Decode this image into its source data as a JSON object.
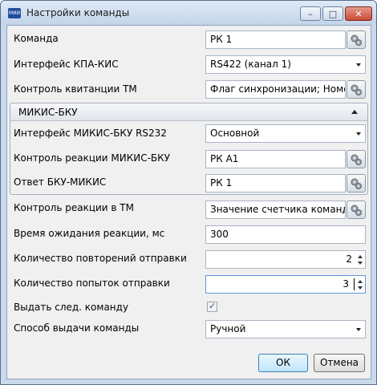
{
  "window": {
    "title": "Настройки команды",
    "icon": "app-logo-icon",
    "icon_text": "МИИ",
    "buttons": {
      "minimize": "–",
      "maximize": "□",
      "close": "✕"
    }
  },
  "fields": {
    "command": {
      "label": "Команда",
      "value": "РК 1"
    },
    "interface_kpa_kis": {
      "label": "Интерфейс КПА-КИС",
      "value": "RS422 (канал 1)"
    },
    "receipt_control_tm": {
      "label": "Контроль квитанции ТМ",
      "value": "Флаг синхронизации; Номер"
    },
    "group": {
      "title": "МИКИС-БКУ",
      "interface": {
        "label": "Интерфейс МИКИС-БКУ RS232",
        "value": "Основной"
      },
      "reaction_control": {
        "label": "Контроль реакции МИКИС-БКУ",
        "value": "РК А1"
      },
      "answer": {
        "label": "Ответ БКУ-МИКИС",
        "value": "РК 1"
      }
    },
    "reaction_control_tm": {
      "label": "Контроль реакции в ТМ",
      "value": "Значение счетчика команд;"
    },
    "wait_time": {
      "label": "Время ожидания реакции, мс",
      "value": "300"
    },
    "repeat_count": {
      "label": "Количество повторений отправки",
      "value": "2"
    },
    "attempt_count": {
      "label": "Количество попыток отправки",
      "value": "3"
    },
    "next_command": {
      "label": "Выдать след. команду",
      "checked": true
    },
    "issue_method": {
      "label": "Способ выдачи команды",
      "value": "Ручной"
    }
  },
  "footer": {
    "ok": "ОК",
    "cancel": "Отмена"
  },
  "colors": {
    "titlebar": "#c3d4ea",
    "close_button": "#c84a34",
    "focus_border": "#5f97d8"
  }
}
